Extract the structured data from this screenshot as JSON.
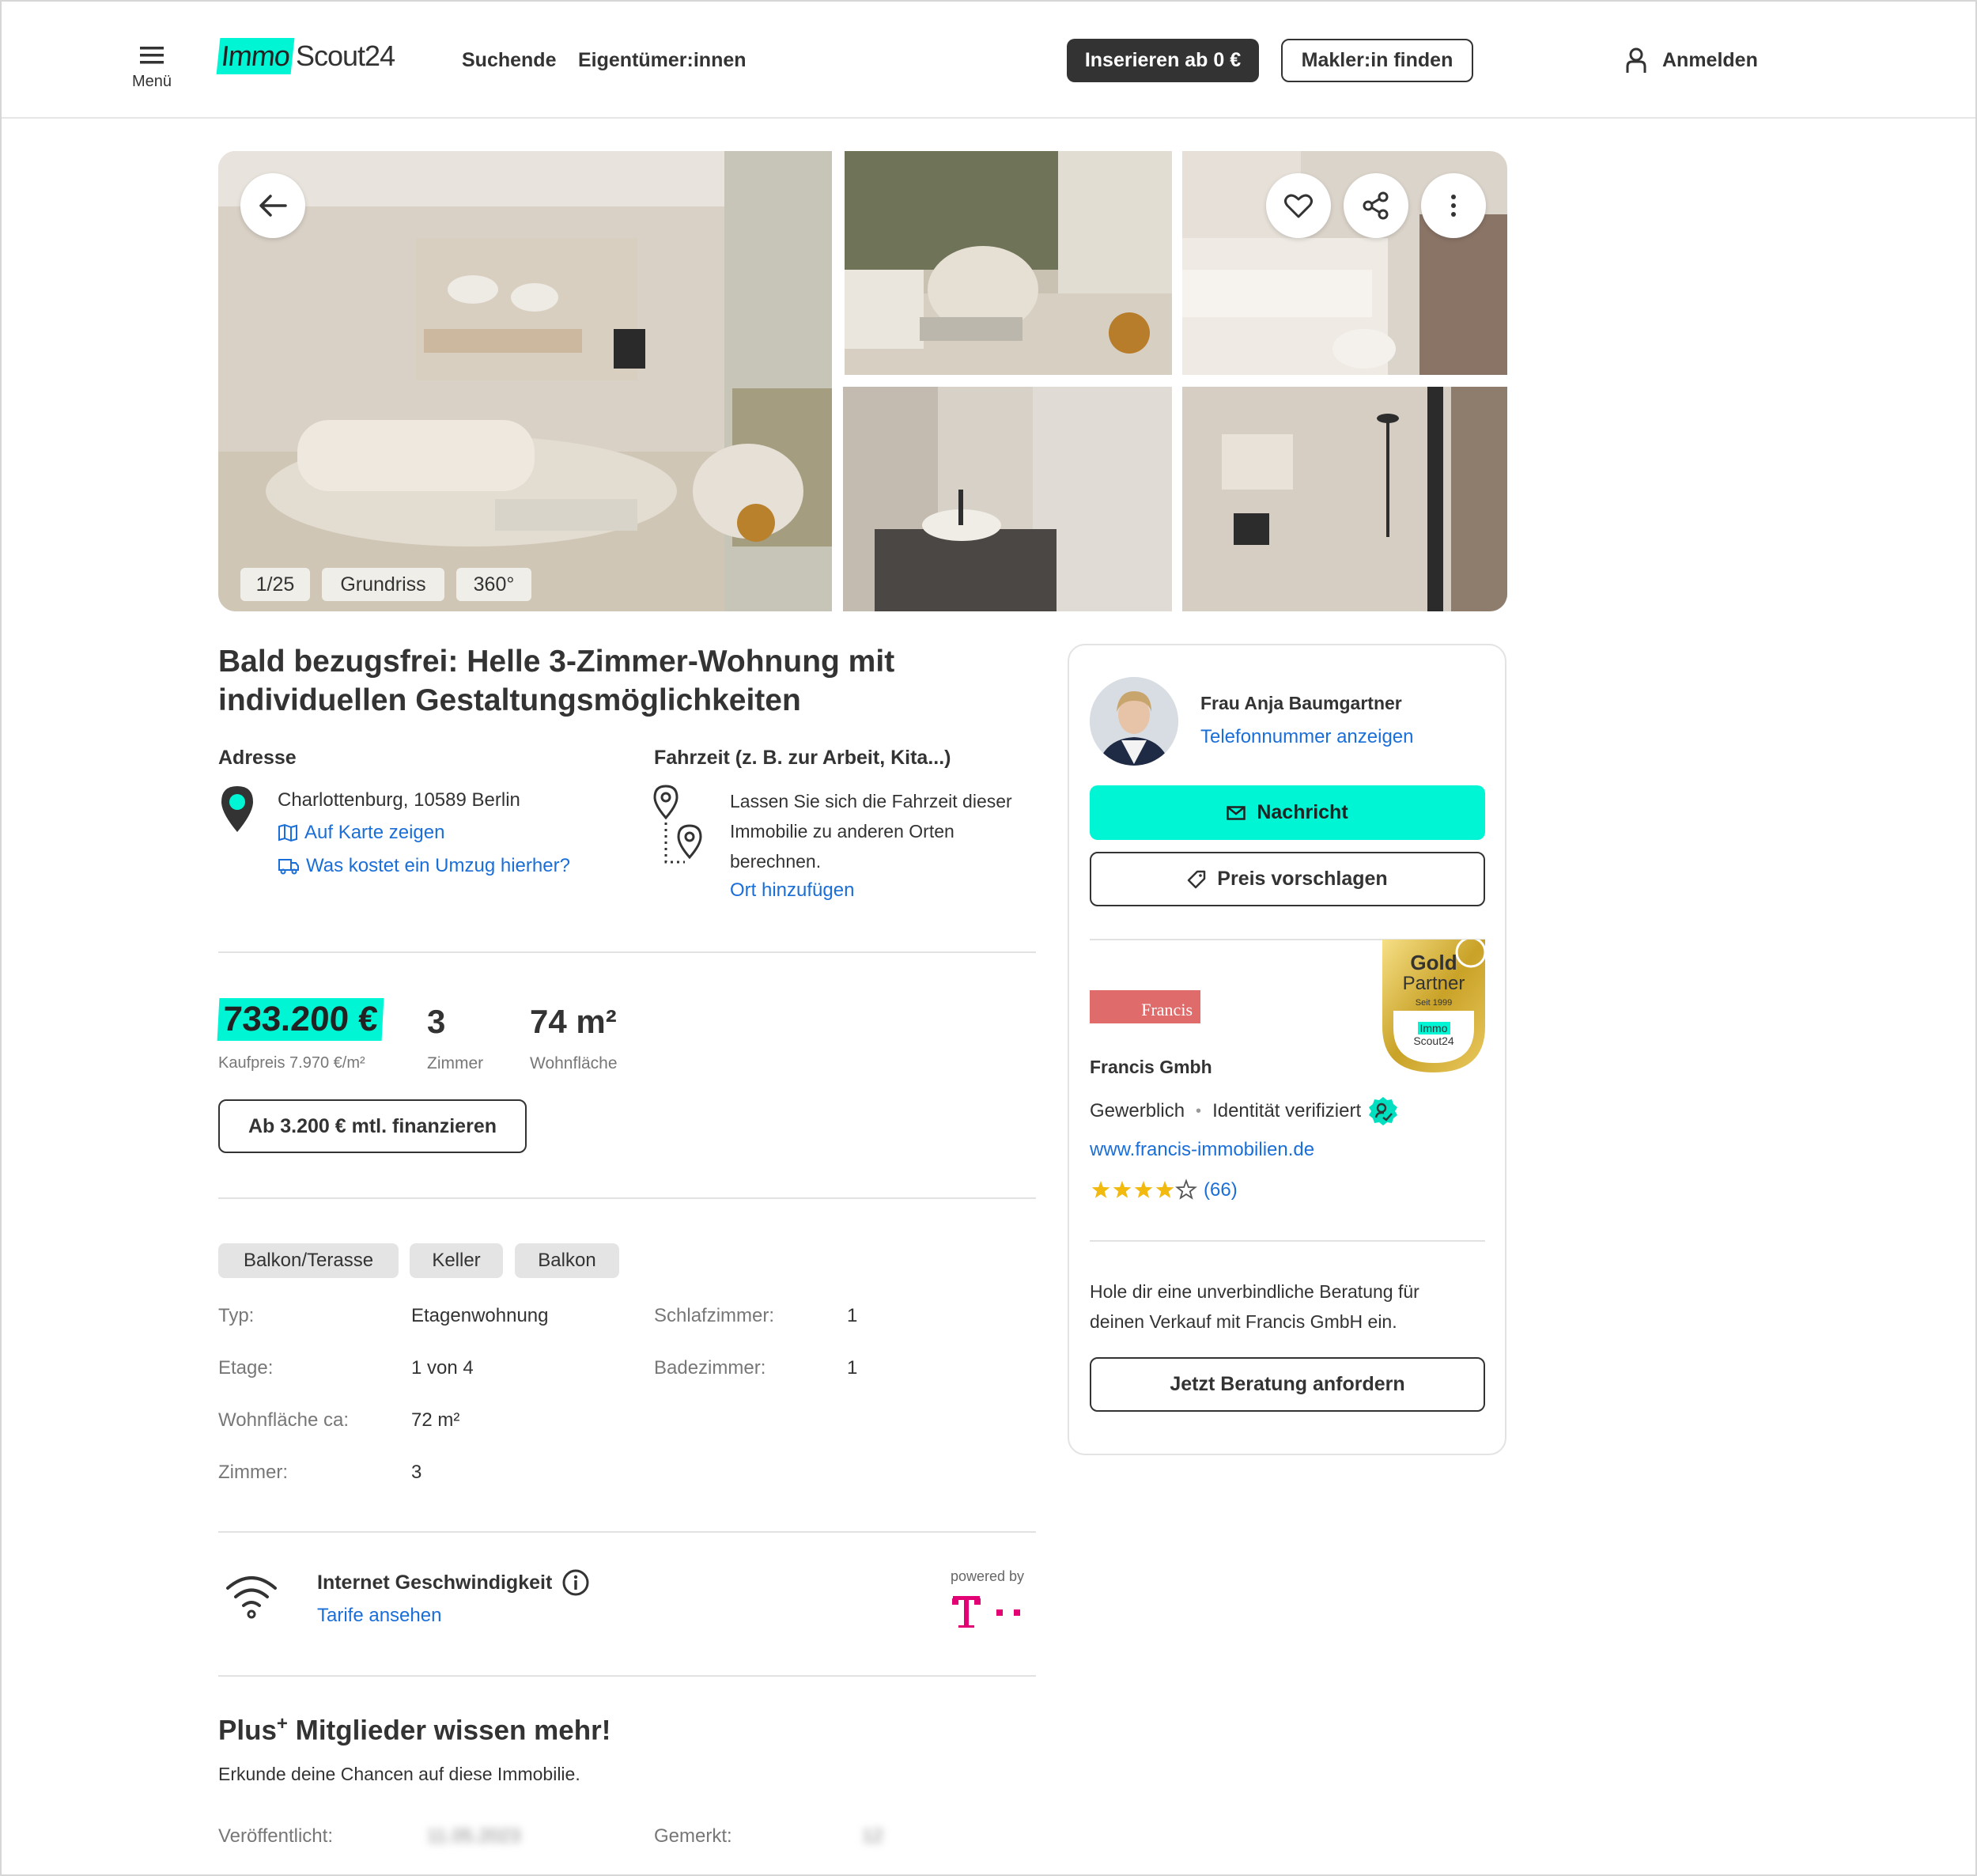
{
  "header": {
    "menu_label": "Menü",
    "logo_part1": "Immo",
    "logo_part2": "Scout24",
    "nav": [
      "Suchende",
      "Eigentümer:innen"
    ],
    "insert_button": "Inserieren ab 0 €",
    "agent_button": "Makler:in finden",
    "login_label": "Anmelden"
  },
  "gallery": {
    "counter": "1/25",
    "floorplan_label": "Grundriss",
    "tour_label": "360°"
  },
  "listing": {
    "title_line1": "Bald bezugsfrei: Helle 3-Zimmer-Wohnung mit",
    "title_line2": "individuellen Gestaltungsmöglichkeiten",
    "address_heading": "Adresse",
    "address": "Charlottenburg, 10589 Berlin",
    "map_link": "Auf Karte zeigen",
    "moving_link": "Was kostet ein Umzug hierher?",
    "commute_heading": "Fahrzeit (z. B. zur Arbeit, Kita...)",
    "commute_line1": "Lassen Sie sich die Fahrzeit dieser",
    "commute_line2": "Immobilie zu anderen Orten",
    "commute_line3": "berechnen.",
    "commute_link": "Ort hinzufügen"
  },
  "key_facts": {
    "price": "733.200 €",
    "price_label": "Kaufpreis 7.970 €/m²",
    "rooms": "3",
    "rooms_label": "Zimmer",
    "area": "74 m²",
    "area_label": "Wohnfläche",
    "finance_button": "Ab 3.200 € mtl. finanzieren"
  },
  "features": [
    "Balkon/Terasse",
    "Keller",
    "Balkon"
  ],
  "attributes_left": [
    {
      "key": "Typ:",
      "value": "Etagenwohnung"
    },
    {
      "key": "Etage:",
      "value": "1 von 4"
    },
    {
      "key": "Wohnfläche ca:",
      "value": "72 m²"
    },
    {
      "key": "Zimmer:",
      "value": "3"
    }
  ],
  "attributes_right": [
    {
      "key": "Schlafzimmer:",
      "value": "1"
    },
    {
      "key": "Badezimmer:",
      "value": "1"
    }
  ],
  "internet": {
    "heading": "Internet Geschwindigkeit",
    "link": "Tarife ansehen",
    "powered_by": "powered by"
  },
  "plus": {
    "title_plus": "Plus",
    "title_rest": " Mitglieder wissen mehr!",
    "subtitle": "Erkunde deine Chancen auf diese Immobilie.",
    "published_label": "Veröffentlicht:",
    "published_value": "11.05.2023",
    "saved_label": "Gemerkt:",
    "saved_value": "12"
  },
  "contact": {
    "name": "Frau Anja Baumgartner",
    "phone_link": "Telefonnummer anzeigen",
    "message_button": "Nachricht",
    "offer_button": "Preis vorschlagen",
    "company_logo_text": "Francis",
    "badge_gold": "Gold",
    "badge_partner": "Partner",
    "badge_since": "Seit 1999",
    "badge_logo1": "Immo",
    "badge_logo2": "Scout24",
    "company": "Francis Gmbh",
    "type": "Gewerblich",
    "verified": "Identität verifiziert",
    "website": "www.francis-immobilien.de",
    "rating": 4,
    "reviews": "(66)",
    "promo_line1": "Hole dir eine unverbindliche Beratung für",
    "promo_line2": "deinen Verkauf mit Francis GmbH ein.",
    "consult_button": "Jetzt Beratung anfordern"
  },
  "colors": {
    "accent": "#00f5d4",
    "link": "#1a6ed8",
    "text": "#333333",
    "telekom": "#e20074",
    "gold": "#c9a227"
  }
}
